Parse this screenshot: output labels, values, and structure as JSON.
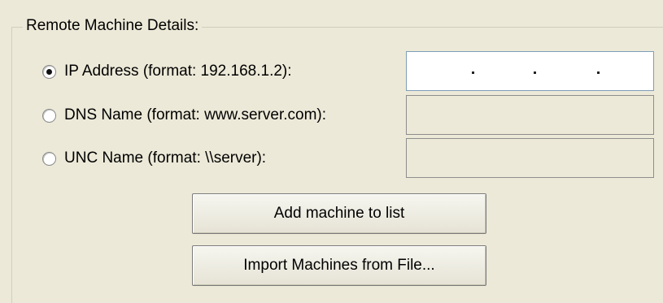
{
  "group": {
    "title": "Remote Machine Details:"
  },
  "options": [
    {
      "label": "IP Address (format: 192.168.1.2):",
      "checked": true
    },
    {
      "label": "DNS Name (format: www.server.com):",
      "checked": false
    },
    {
      "label": "UNC Name (format: \\\\server):",
      "checked": false
    }
  ],
  "inputs": {
    "ip_value": "",
    "dns_value": "",
    "unc_value": ""
  },
  "buttons": {
    "add": "Add machine to list",
    "import": "Import Machines from File..."
  }
}
